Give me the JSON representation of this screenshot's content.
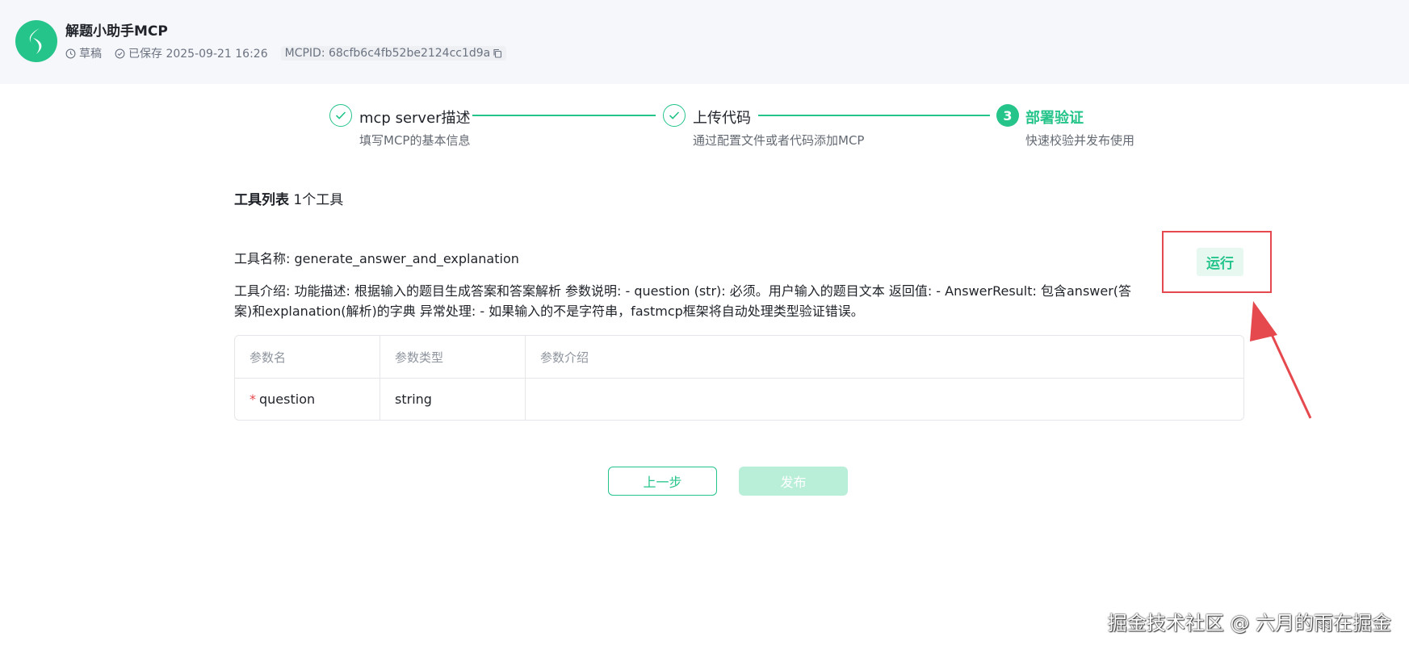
{
  "header": {
    "title": "解题小助手MCP",
    "status": "草稿",
    "saved": "已保存 2025-09-21 16:26",
    "mcpid": "MCPID: 68cfb6c4fb52be2124cc1d9a"
  },
  "steps": [
    {
      "title": "mcp server描述",
      "desc": "填写MCP的基本信息",
      "state": "done"
    },
    {
      "title": "上传代码",
      "desc": "通过配置文件或者代码添加MCP",
      "state": "done"
    },
    {
      "number": "3",
      "title": "部署验证",
      "desc": "快速校验并发布使用",
      "state": "active"
    }
  ],
  "tools": {
    "heading": "工具列表",
    "count": "1个工具",
    "name_line": "工具名称: generate_answer_and_explanation",
    "desc_line": "工具介绍: 功能描述: 根据输入的题目生成答案和答案解析 参数说明: - question (str): 必须。用户输入的题目文本 返回值: - AnswerResult: 包含answer(答案)和explanation(解析)的字典 异常处理: - 如果输入的不是字符串，fastmcp框架将自动处理类型验证错误。",
    "run_label": "运行"
  },
  "table": {
    "headers": [
      "参数名",
      "参数类型",
      "参数介绍"
    ],
    "rows": [
      {
        "required": "*",
        "name": "question",
        "type": "string",
        "desc": ""
      }
    ]
  },
  "footer": {
    "prev_label": "上一步",
    "publish_label": "发布"
  },
  "watermark": "掘金技术社区 @ 六月的雨在掘金",
  "colors": {
    "accent": "#25c48a",
    "annotation": "#e5484d"
  }
}
